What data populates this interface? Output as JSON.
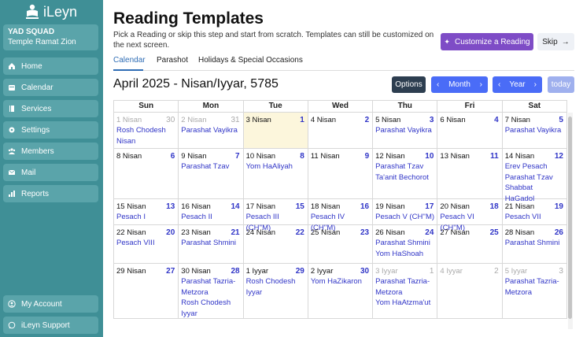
{
  "app": {
    "name": "iLeyn"
  },
  "org": {
    "name": "YAD SQUAD",
    "subtitle": "Temple Ramat Zion"
  },
  "nav": [
    {
      "label": "Home",
      "icon": "home-icon"
    },
    {
      "label": "Calendar",
      "icon": "calendar-icon"
    },
    {
      "label": "Services",
      "icon": "book-icon"
    },
    {
      "label": "Settings",
      "icon": "gear-icon"
    },
    {
      "label": "Members",
      "icon": "people-icon"
    },
    {
      "label": "Mail",
      "icon": "mail-icon"
    },
    {
      "label": "Reports",
      "icon": "bar-chart-icon"
    }
  ],
  "nav_bottom": [
    {
      "label": "My Account",
      "icon": "user-circle-icon"
    },
    {
      "label": "iLeyn Support",
      "icon": "chat-icon"
    }
  ],
  "page": {
    "title": "Reading Templates",
    "subtitle": "Pick a Reading or skip this step and start from scratch. Templates can still be customized on the next screen.",
    "customize_label": "Customize a Reading",
    "skip_label": "Skip"
  },
  "tabs": [
    {
      "label": "Calendar",
      "active": true
    },
    {
      "label": "Parashot",
      "active": false
    },
    {
      "label": "Holidays & Special Occasions",
      "active": false
    }
  ],
  "calendar": {
    "title": "April 2025 - Nisan/Iyyar, 5785",
    "options_label": "Options",
    "month_label": "Month",
    "year_label": "Year",
    "today_label": "today",
    "days_of_week": [
      "Sun",
      "Mon",
      "Tue",
      "Wed",
      "Thu",
      "Fri",
      "Sat"
    ],
    "weeks": [
      [
        {
          "heb": "1 Nisan",
          "greg": "30",
          "other": true,
          "events": [
            "Rosh Chodesh Nisan"
          ]
        },
        {
          "heb": "2 Nisan",
          "greg": "31",
          "other": true,
          "events": [
            "Parashat Vayikra"
          ]
        },
        {
          "heb": "3 Nisan",
          "greg": "1",
          "today": true,
          "events": []
        },
        {
          "heb": "4 Nisan",
          "greg": "2",
          "events": []
        },
        {
          "heb": "5 Nisan",
          "greg": "3",
          "events": [
            "Parashat Vayikra"
          ]
        },
        {
          "heb": "6 Nisan",
          "greg": "4",
          "events": []
        },
        {
          "heb": "7 Nisan",
          "greg": "5",
          "events": [
            "Parashat Vayikra"
          ]
        }
      ],
      [
        {
          "heb": "8 Nisan",
          "greg": "6",
          "events": []
        },
        {
          "heb": "9 Nisan",
          "greg": "7",
          "events": [
            "Parashat Tzav"
          ]
        },
        {
          "heb": "10 Nisan",
          "greg": "8",
          "events": [
            "Yom HaAliyah"
          ]
        },
        {
          "heb": "11 Nisan",
          "greg": "9",
          "events": []
        },
        {
          "heb": "12 Nisan",
          "greg": "10",
          "events": [
            "Parashat Tzav",
            "Ta'anit Bechorot"
          ]
        },
        {
          "heb": "13 Nisan",
          "greg": "11",
          "events": []
        },
        {
          "heb": "14 Nisan",
          "greg": "12",
          "events": [
            "Erev Pesach",
            "Parashat Tzav",
            "Shabbat HaGadol"
          ]
        }
      ],
      [
        {
          "heb": "15 Nisan",
          "greg": "13",
          "events": [
            "Pesach I"
          ]
        },
        {
          "heb": "16 Nisan",
          "greg": "14",
          "events": [
            "Pesach II"
          ]
        },
        {
          "heb": "17 Nisan",
          "greg": "15",
          "events": [
            "Pesach III (CH''M)"
          ]
        },
        {
          "heb": "18 Nisan",
          "greg": "16",
          "events": [
            "Pesach IV (CH''M)"
          ]
        },
        {
          "heb": "19 Nisan",
          "greg": "17",
          "events": [
            "Pesach V (CH''M)"
          ]
        },
        {
          "heb": "20 Nisan",
          "greg": "18",
          "events": [
            "Pesach VI (CH''M)"
          ]
        },
        {
          "heb": "21 Nisan",
          "greg": "19",
          "events": [
            "Pesach VII"
          ]
        }
      ],
      [
        {
          "heb": "22 Nisan",
          "greg": "20",
          "events": [
            "Pesach VIII"
          ]
        },
        {
          "heb": "23 Nisan",
          "greg": "21",
          "events": [
            "Parashat Shmini"
          ]
        },
        {
          "heb": "24 Nisan",
          "greg": "22",
          "events": []
        },
        {
          "heb": "25 Nisan",
          "greg": "23",
          "events": []
        },
        {
          "heb": "26 Nisan",
          "greg": "24",
          "events": [
            "Parashat Shmini",
            "Yom HaShoah"
          ]
        },
        {
          "heb": "27 Nisan",
          "greg": "25",
          "events": []
        },
        {
          "heb": "28 Nisan",
          "greg": "26",
          "events": [
            "Parashat Shmini"
          ]
        }
      ],
      [
        {
          "heb": "29 Nisan",
          "greg": "27",
          "events": []
        },
        {
          "heb": "30 Nisan",
          "greg": "28",
          "events": [
            "Parashat Tazria-Metzora",
            "Rosh Chodesh Iyyar"
          ]
        },
        {
          "heb": "1 Iyyar",
          "greg": "29",
          "events": [
            "Rosh Chodesh Iyyar"
          ]
        },
        {
          "heb": "2 Iyyar",
          "greg": "30",
          "events": [
            "Yom HaZikaron"
          ]
        },
        {
          "heb": "3 Iyyar",
          "greg": "1",
          "other": true,
          "events": [
            "Parashat Tazria-Metzora",
            "Yom HaAtzma'ut"
          ]
        },
        {
          "heb": "4 Iyyar",
          "greg": "2",
          "other": true,
          "events": []
        },
        {
          "heb": "5 Iyyar",
          "greg": "3",
          "other": true,
          "events": [
            "Parashat Tazria-Metzora"
          ]
        }
      ]
    ]
  },
  "colors": {
    "sidebar": "#3f8f96",
    "accent_purple": "#7e4cc6",
    "accent_blue": "#4a6cf7",
    "event_text": "#3035c7",
    "today_bg": "#fcf6dc"
  }
}
